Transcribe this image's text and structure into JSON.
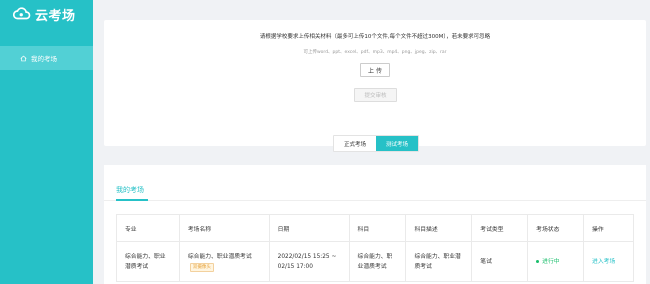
{
  "app": {
    "title": "云考场"
  },
  "sidebar": {
    "items": [
      {
        "label": "我的考场"
      }
    ]
  },
  "upload": {
    "tip": "请根据学校要求上传相关材料（最多可上传10个文件,每个文件不超过300M），若未要求可忽略",
    "formats": "可上传word、ppt、excel、pdf、mp3、mp4、png、jpeg、zip、rar",
    "upload_label": "上 传",
    "submit_label": "提交审核"
  },
  "tabs": [
    {
      "label": "正式考场"
    },
    {
      "label": "测试考场"
    }
  ],
  "section": {
    "title": "我的考场"
  },
  "table": {
    "headers": [
      "专业",
      "考场名称",
      "日期",
      "科目",
      "科目描述",
      "考试类型",
      "考场状态",
      "操作"
    ],
    "rows": [
      {
        "major": "综合能力、职业潜质考试",
        "name": "综合能力、职业潜质考试",
        "badge": "双摄像头",
        "date": "2022/02/15 15:25 ~ 02/15 17:00",
        "subject": "综合能力、职业潜质考试",
        "subject_desc": "综合能力、职业潜质考试",
        "type": "笔试",
        "status": "进行中",
        "action": "进入考场"
      }
    ]
  },
  "colors": {
    "accent": "#26c1c7",
    "status_green": "#19be6b"
  }
}
